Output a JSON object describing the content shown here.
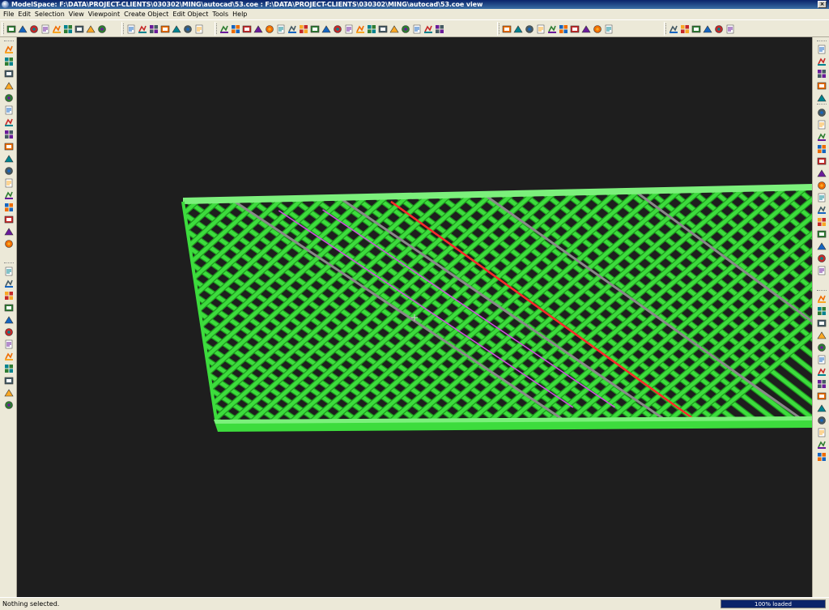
{
  "window": {
    "title": "ModelSpace: F:\\DATA\\PROJECT-CLIENTS\\030302\\MING\\autocad\\53.coe : F:\\DATA\\PROJECT-CLIENTS\\030302\\MING\\autocad\\53.coe view",
    "close_glyph": "×"
  },
  "menu": {
    "items": [
      {
        "label": "File"
      },
      {
        "label": "Edit"
      },
      {
        "label": "Selection"
      },
      {
        "label": "View"
      },
      {
        "label": "Viewpoint"
      },
      {
        "label": "Create Object"
      },
      {
        "label": "Edit Object"
      },
      {
        "label": "Tools"
      },
      {
        "label": "Help"
      }
    ]
  },
  "toolbar": {
    "groups": [
      {
        "icons": [
          "edit-icon",
          "save-icon",
          "explorer-icon",
          "palette-icon",
          "picture-icon",
          "undo-icon",
          "redo-icon",
          "print-icon",
          "pencil-icon"
        ]
      },
      {
        "icons": [
          "lasso-select-icon",
          "copy-icon",
          "align-icon",
          "move-icon",
          "camera-icon",
          "help-cursor-icon",
          "render-icon"
        ]
      },
      {
        "icons": [
          "grid-icon",
          "grid-alt-icon",
          "beam-icon",
          "column-icon",
          "brace-icon",
          "joist-icon",
          "truss-icon",
          "plate-icon",
          "connection-icon",
          "bolt-icon",
          "weld-icon",
          "snake-icon",
          "stair-icon",
          "ramp-icon",
          "wrench-icon",
          "hole-icon",
          "pipe-icon",
          "rebar-icon",
          "fitting-icon",
          "wall-icon"
        ]
      },
      {
        "icons": [
          "box-icon",
          "box-alt-icon",
          "layers-icon",
          "shade-icon",
          "clip-icon",
          "measure-icon",
          "section-icon",
          "elevation-icon",
          "plan-icon",
          "isometric-icon"
        ]
      },
      {
        "icons": [
          "dot-icon",
          "sphere-icon",
          "fog-icon",
          "light-icon",
          "spot-icon",
          "ambient-icon"
        ]
      }
    ]
  },
  "left_toolbar": {
    "groups": [
      {
        "icons": [
          "move-icon",
          "layers-icon",
          "arrow-up-icon",
          "arrow-up-right-icon",
          "z-arrow-icon",
          "beam-icon",
          "beam-alt-icon",
          "column-icon",
          "brace-icon",
          "plate-icon",
          "joint-icon",
          "connect-icon",
          "disconnect-icon",
          "nodes-icon",
          "stair-icon",
          "ball-icon",
          "sphere-icon"
        ]
      },
      {
        "icons": [
          "cube-icon",
          "grid-icon",
          "grid-alt-icon",
          "axis-icon",
          "curve-icon",
          "dim-icon",
          "door-icon",
          "window-icon",
          "shelf-icon",
          "stack-icon",
          "cabinet-icon",
          "wall-icon"
        ]
      }
    ]
  },
  "right_toolbar": {
    "groups": [
      {
        "icons": [
          "wrench-icon",
          "tool-icon",
          "plug-icon",
          "gear-icon",
          "valve-icon"
        ]
      },
      {
        "icons": [
          "pipe-icon",
          "elbow-icon",
          "tee-icon",
          "reducer-icon",
          "flange-icon",
          "cap-icon",
          "cross-icon",
          "bend-icon",
          "weld-icon",
          "bolt-icon",
          "nut-icon",
          "strap-icon",
          "hanger-icon",
          "support-icon"
        ]
      },
      {
        "icons": [
          "tee-alt-icon",
          "rail-icon",
          "ladder-icon",
          "cage-icon",
          "grate-icon",
          "angle-icon",
          "channel-icon",
          "ibeam-icon",
          "tube-icon",
          "plate-icon",
          "bar-icon",
          "rod-icon",
          "cable-icon",
          "tag-icon"
        ]
      }
    ]
  },
  "viewport": {
    "background": "#1e1e1e",
    "colors": {
      "beam": "#3ddc3d",
      "beam_top": "#7cf07c",
      "beam_dark": "#1f9a1f",
      "highlight_red": "#ff2a2a",
      "highlight_magenta": "#d050e0",
      "gray_member": "#8a8a8a"
    }
  },
  "status": {
    "text": "Nothing selected.",
    "progress_label": "100% loaded",
    "progress_fraction": 1.0
  }
}
